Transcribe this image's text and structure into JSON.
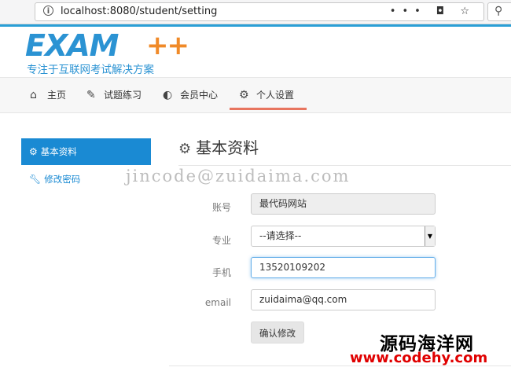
{
  "browser": {
    "url": "localhost:8080/student/setting",
    "actions_label": "•••  ◘  ☆",
    "search_icon": "search-icon"
  },
  "logo": {
    "word": "EXAM",
    "plus": "++",
    "tagline": "专注于互联网考试解决方案"
  },
  "nav": {
    "items": [
      {
        "label": "主页",
        "icon": "home-icon"
      },
      {
        "label": "试题练习",
        "icon": "edit-icon"
      },
      {
        "label": "会员中心",
        "icon": "dashboard-icon"
      },
      {
        "label": "个人设置",
        "icon": "gears-icon",
        "active": true
      }
    ]
  },
  "sidebar": {
    "items": [
      {
        "label": "基本资料",
        "icon": "gears-icon",
        "active": true
      },
      {
        "label": "修改密码",
        "icon": "wrench-icon",
        "active": false
      }
    ]
  },
  "main": {
    "title": "基本资料",
    "watermark": "jincode@zuidaima.com",
    "form": {
      "account_label": "账号",
      "account_value": "最代码网站",
      "major_label": "专业",
      "major_value": "--请选择--",
      "phone_label": "手机",
      "phone_value": "13520109202",
      "email_label": "email",
      "email_value": "zuidaima@qq.com",
      "submit_label": "确认修改"
    }
  },
  "overlay": {
    "brand_cn": "源码海洋网",
    "brand_url": "www.codehy.com"
  },
  "colors": {
    "accent": "#1a8ad3",
    "nav_active_underline": "#e8755f",
    "logo_blue": "#2b93d3",
    "logo_orange": "#f08a28"
  }
}
